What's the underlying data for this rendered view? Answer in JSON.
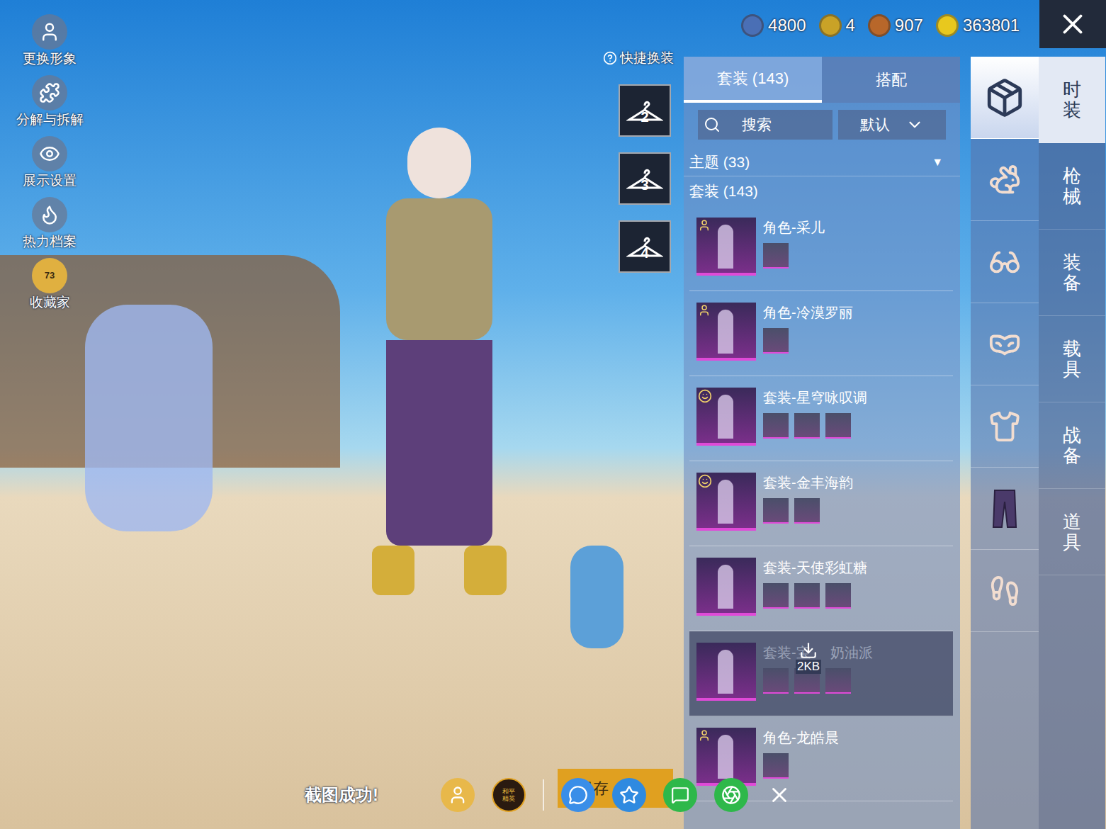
{
  "currencies": [
    {
      "amount": "4800",
      "color": "#4a6fb5"
    },
    {
      "amount": "4",
      "color": "#c9a227"
    },
    {
      "amount": "907",
      "color": "#b8672a"
    },
    {
      "amount": "363801",
      "color": "#e8c81e"
    }
  ],
  "left_menu": [
    {
      "label": "更换形象",
      "badge": ""
    },
    {
      "label": "分解与拆解",
      "badge": ""
    },
    {
      "label": "展示设置",
      "badge": ""
    },
    {
      "label": "热力档案",
      "badge": ""
    },
    {
      "label": "收藏家",
      "badge": "73"
    }
  ],
  "quick_change": {
    "label": "快捷换装",
    "slots": [
      "2",
      "3",
      "4"
    ]
  },
  "panel": {
    "tabs": [
      {
        "label": "套装 (143)",
        "selected": true
      },
      {
        "label": "搭配",
        "selected": false
      }
    ],
    "search": {
      "placeholder": "搜索"
    },
    "sort": {
      "value": "默认"
    },
    "theme_filter": {
      "label": "主题 (33)",
      "arrow": "▼"
    },
    "list_heading": "套装 (143)",
    "items": [
      {
        "title": "角色-采儿",
        "title_after": "",
        "badge": "role",
        "parts": 1,
        "downloading": false,
        "download_size": ""
      },
      {
        "title": "角色-冷漠罗丽",
        "title_after": "",
        "badge": "role",
        "parts": 1,
        "downloading": false,
        "download_size": ""
      },
      {
        "title": "套装-星穹咏叹调",
        "title_after": "",
        "badge": "smile",
        "parts": 3,
        "downloading": false,
        "download_size": ""
      },
      {
        "title": "套装-金丰海韵",
        "title_after": "",
        "badge": "smile",
        "parts": 2,
        "downloading": false,
        "download_size": ""
      },
      {
        "title": "套装-天使彩虹糖",
        "title_after": "",
        "badge": "none",
        "parts": 3,
        "downloading": false,
        "download_size": ""
      },
      {
        "title": "套装-宝",
        "title_after": "奶油派",
        "badge": "none",
        "parts": 3,
        "downloading": true,
        "download_size": "2KB"
      },
      {
        "title": "角色-龙皓晨",
        "title_after": "",
        "badge": "role",
        "parts": 1,
        "downloading": false,
        "download_size": ""
      }
    ]
  },
  "categories": [
    {
      "selected": true
    },
    {
      "selected": false
    },
    {
      "selected": false
    },
    {
      "selected": false
    },
    {
      "selected": false
    },
    {
      "selected": false
    },
    {
      "selected": false
    }
  ],
  "main_tabs": [
    {
      "label": "时装",
      "selected": true
    },
    {
      "label": "枪械",
      "selected": false
    },
    {
      "label": "装备",
      "selected": false
    },
    {
      "label": "载具",
      "selected": false
    },
    {
      "label": "战备",
      "selected": false
    },
    {
      "label": "道具",
      "selected": false
    }
  ],
  "share_bar": {
    "message": "截图成功!",
    "save_button": "保存",
    "logo_text": "和平精英"
  }
}
